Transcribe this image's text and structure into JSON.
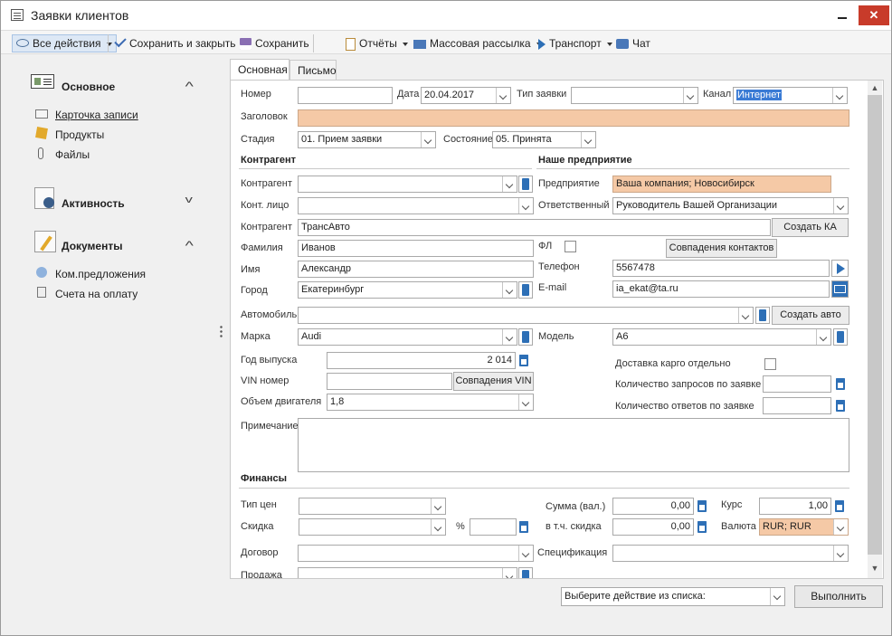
{
  "window": {
    "title": "Заявки клиентов",
    "close": "✕"
  },
  "toolbar": {
    "all_actions": "Все действия",
    "save_close": "Сохранить и закрыть",
    "save": "Сохранить",
    "reports": "Отчёты",
    "mass_mail": "Массовая рассылка",
    "transport": "Транспорт",
    "chat": "Чат"
  },
  "sidebar": {
    "main": {
      "title": "Основное",
      "items": [
        "Карточка записи",
        "Продукты",
        "Файлы"
      ]
    },
    "activity": {
      "title": "Активность"
    },
    "docs": {
      "title": "Документы",
      "items": [
        "Ком.предложения",
        "Счета на оплату"
      ]
    }
  },
  "tabs": [
    "Основная",
    "Письмо"
  ],
  "form": {
    "number_label": "Номер",
    "number": "",
    "date_label": "Дата",
    "date": "20.04.2017",
    "type_label": "Тип заявки",
    "type": "",
    "channel_label": "Канал",
    "channel": "Интернет",
    "title_label": "Заголовок",
    "title": "",
    "stage_label": "Стадия",
    "stage": "01. Прием заявки",
    "state_label": "Состояние",
    "state": "05. Принята",
    "contractor_header": "Контрагент",
    "enterprise_header": "Наше предприятие",
    "contractor_label": "Контрагент",
    "contractor": "",
    "contact_label": "Конт. лицо",
    "contact": "",
    "contractor2_label": "Контрагент",
    "contractor2": "ТрансАвто",
    "create_ka": "Создать КА",
    "company_label": "Предприятие",
    "company": "Ваша компания; Новосибирск",
    "responsible_label": "Ответственный",
    "responsible": "Руководитель Вашей Организации",
    "surname_label": "Фамилия",
    "surname": "Иванов",
    "fl_label": "ФЛ",
    "contacts_match": "Совпадения контактов",
    "name_label": "Имя",
    "name": "Александр",
    "phone_label": "Телефон",
    "phone": "5567478",
    "city_label": "Город",
    "city": "Екатеринбург",
    "email_label": "E-mail",
    "email": "ia_ekat@ta.ru",
    "car_label": "Автомобиль",
    "car": "",
    "create_car": "Создать авто",
    "brand_label": "Марка",
    "brand": "Audi",
    "model_label": "Модель",
    "model": "A6",
    "year_label": "Год выпуска",
    "year": "2 014",
    "cargo_label": "Доставка карго отдельно",
    "vin_label": "VIN номер",
    "vin": "",
    "vin_match": "Совпадения VIN",
    "req_count_label": "Количество запросов по заявке",
    "req_count": "",
    "engine_label": "Объем двигателя",
    "engine": "1,8",
    "ans_count_label": "Количество ответов по заявке",
    "ans_count": "",
    "note_label": "Примечание",
    "note": "",
    "finance_header": "Финансы",
    "price_type_label": "Тип цен",
    "price_type": "",
    "sum_label": "Сумма (вал.)",
    "sum": "0,00",
    "rate_label": "Курс",
    "rate": "1,00",
    "discount_label": "Скидка",
    "discount": "",
    "percent_label": "%",
    "percent": "",
    "incl_discount_label": "в т.ч. скидка",
    "incl_discount": "0,00",
    "currency_label": "Валюта",
    "currency": "RUR; RUR",
    "contract_label": "Договор",
    "contract": "",
    "spec_label": "Спецификация",
    "spec": "",
    "sale_label": "Продажа",
    "sale": ""
  },
  "bottom": {
    "action_placeholder": "Выберите действие из списка:",
    "execute": "Выполнить"
  }
}
